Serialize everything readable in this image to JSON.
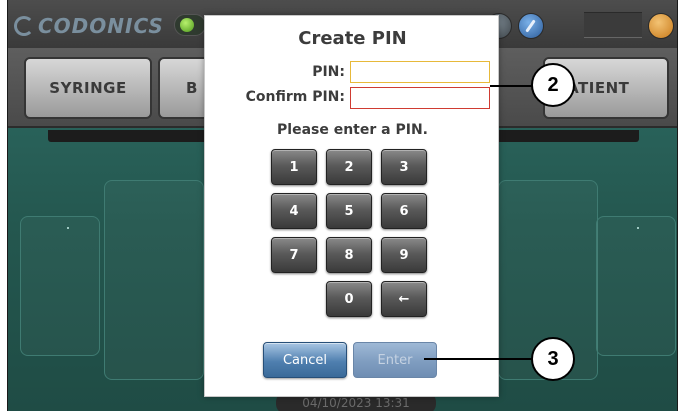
{
  "app": {
    "logo_text": "CODONICS"
  },
  "tabs": [
    {
      "label": "SYRINGE"
    },
    {
      "label": "B"
    },
    {
      "label": "PATIENT"
    }
  ],
  "status": {
    "timestamp": "04/10/2023 13:31"
  },
  "dialog": {
    "title": "Create PIN",
    "pin_label": "PIN:",
    "pin_value": "",
    "confirm_label": "Confirm PIN:",
    "confirm_value": "",
    "message": "Please enter a PIN.",
    "keypad": [
      "1",
      "2",
      "3",
      "4",
      "5",
      "6",
      "7",
      "8",
      "9",
      "0",
      "←"
    ],
    "cancel_label": "Cancel",
    "enter_label": "Enter",
    "enter_enabled": false
  },
  "callouts": [
    {
      "number": "2"
    },
    {
      "number": "3"
    }
  ],
  "colors": {
    "pin_field_border": "#e7b93a",
    "confirm_field_border": "#cf3b32",
    "cancel_button": "#4f7faf",
    "enter_button_disabled": "#7f9dc0",
    "status_led": "#6fc72a",
    "background_teal": "#2f6f67"
  },
  "icons": {
    "status_led": "green-led-icon",
    "help": "pen-icon",
    "power": "power-icon",
    "backspace": "backspace-arrow-icon"
  }
}
